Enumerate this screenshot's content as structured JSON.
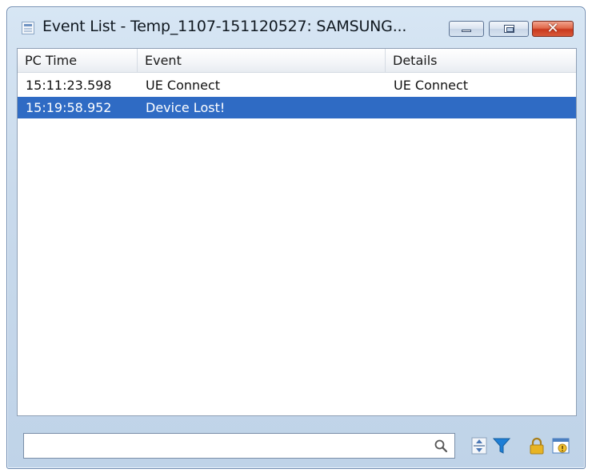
{
  "window": {
    "title": "Event List - Temp_1107-151120527: SAMSUNG...",
    "close_glyph": "✕"
  },
  "table": {
    "columns": [
      "PC Time",
      "Event",
      "Details"
    ],
    "rows": [
      {
        "pc_time": "15:11:23.598",
        "event": "UE Connect",
        "details": "UE Connect",
        "selected": false
      },
      {
        "pc_time": "15:19:58.952",
        "event": "Device Lost!",
        "details": "",
        "selected": true
      }
    ]
  },
  "search": {
    "value": "",
    "placeholder": ""
  },
  "toolbar": {
    "icons": [
      "search-icon",
      "expand-collapse-icon",
      "filter-icon",
      "lock-icon",
      "info-window-icon"
    ]
  },
  "colors": {
    "selection": "#2f6bc4",
    "filter": "#1e7fd6",
    "lock": "#e8b423"
  }
}
